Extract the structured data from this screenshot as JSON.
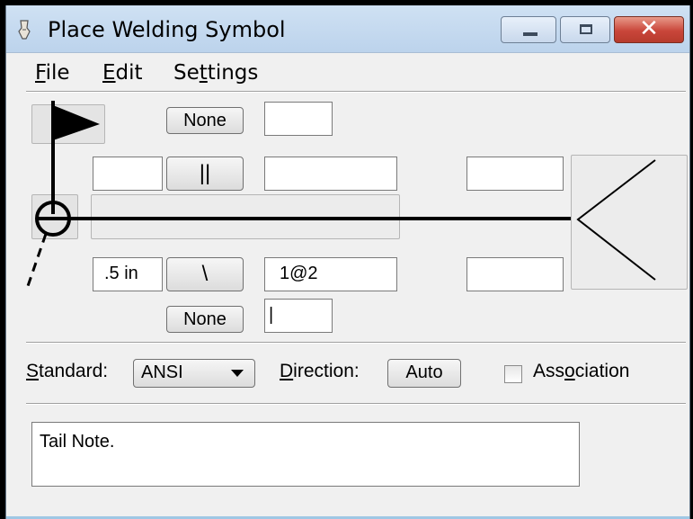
{
  "window": {
    "title": "Place Welding Symbol"
  },
  "title_buttons": {
    "close_glyph": "✕"
  },
  "menu": [
    {
      "label": "File"
    },
    {
      "label": "Edit"
    },
    {
      "label": "Settings"
    }
  ],
  "symbol": {
    "arrow_side_top_button": "None",
    "parallel_button": "||",
    "size_field": ".5 in",
    "bevel_button": "\\",
    "length_pitch_field": "1@2",
    "bottom_button": "None",
    "bottom_field": "|"
  },
  "options": {
    "standard_label": "Standard:",
    "standard_value": "ANSI",
    "direction_label": "Direction:",
    "direction_value": "Auto",
    "association_label": "Association",
    "association_checked": false
  },
  "tail_note": "Tail Note."
}
